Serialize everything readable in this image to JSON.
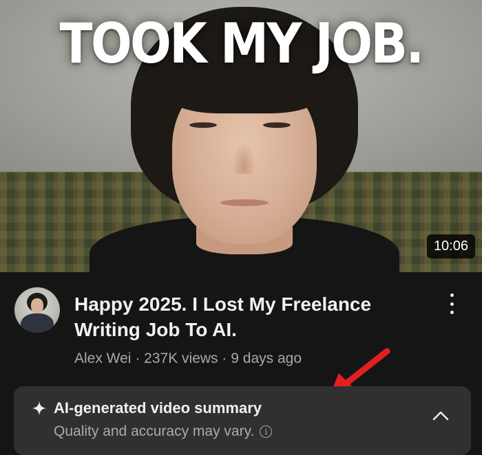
{
  "thumbnail": {
    "overlay_text": "TOOK MY JOB.",
    "duration": "10:06"
  },
  "video": {
    "title": "Happy 2025. I Lost My Freelance Writing Job To AI.",
    "channel": "Alex Wei",
    "views": "237K views",
    "age": "9 days ago",
    "separator": "·"
  },
  "ai_summary": {
    "title": "AI-generated video summary",
    "subtitle": "Quality and accuracy may vary.",
    "info_glyph": "i"
  },
  "colors": {
    "background": "#151515",
    "summary_card": "#303030",
    "arrow_annotation": "#e02020"
  },
  "icons": [
    "sparkle-icon",
    "info-icon",
    "chevron-up-icon",
    "more-vert-icon",
    "red-arrow-annotation"
  ]
}
